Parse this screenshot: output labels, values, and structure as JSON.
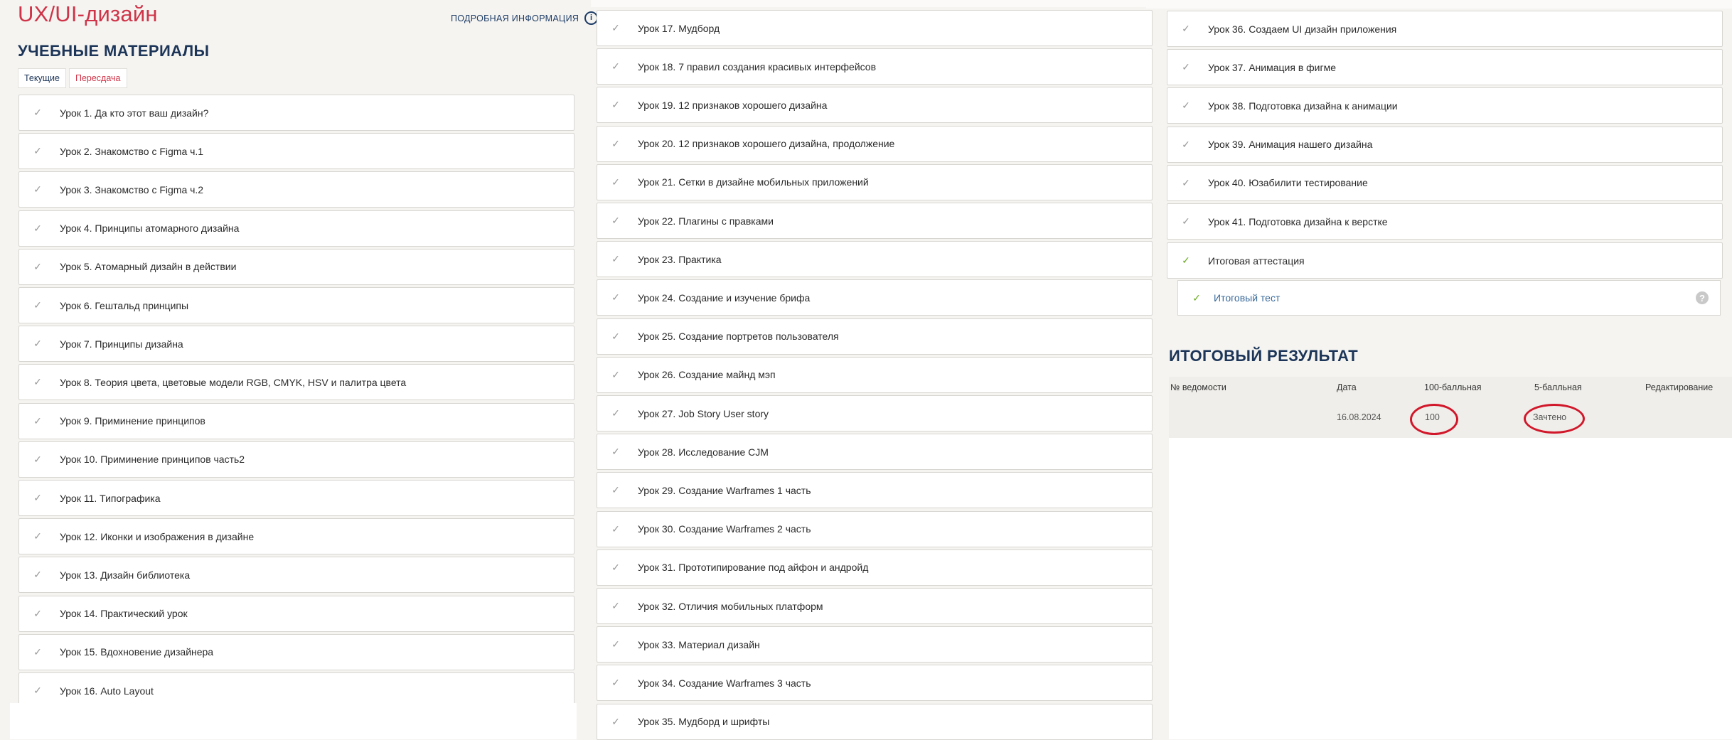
{
  "course": {
    "title": "UX/UI-дизайн",
    "info_link": "ПОДРОБНАЯ ИНФОРМАЦИЯ",
    "info_icon": "info-icon"
  },
  "materials": {
    "title": "УЧЕБНЫЕ МАТЕРИАЛЫ",
    "tabs": [
      {
        "label": "Текущие",
        "active": true
      },
      {
        "label": "Пересдача",
        "active": false
      }
    ]
  },
  "lessons": [
    "Урок 1. Да кто этот ваш дизайн?",
    "Урок 2. Знакомство с Figma ч.1",
    "Урок 3. Знакомство с Figma ч.2",
    "Урок 4. Принципы атомарного дизайна",
    "Урок 5. Атомарный дизайн в действии",
    "Урок 6. Гештальд принципы",
    "Урок 7. Принципы дизайна",
    "Урок 8. Теория цвета, цветовые модели RGB, CMYK, HSV и палитра цвета",
    "Урок 9. Приминение принципов",
    "Урок 10. Приминение принципов часть2",
    "Урок 11. Типографика",
    "Урок 12. Иконки и изображения в дизайне",
    "Урок 13. Дизайн библиотека",
    "Урок 14. Практический урок",
    "Урок 15. Вдохновение дизайнера",
    "Урок 16. Auto Layout",
    "Урок 17. Мудборд",
    "Урок 18. 7 правил создания красивых интерфейсов",
    "Урок 19. 12 признаков хорошего дизайна",
    "Урок 20. 12 признаков хорошего дизайна, продолжение",
    "Урок 21. Сетки в дизайне мобильных приложений",
    "Урок 22. Плагины с правками",
    "Урок 23. Практика",
    "Урок 24. Создание и изучение брифа",
    "Урок 25. Создание портретов пользователя",
    "Урок 26. Создание майнд мэп",
    "Урок 27. Job Story User story",
    "Урок 28. Исследование CJM",
    "Урок 29. Создание Warframes 1 часть",
    "Урок 30. Создание Warframes 2 часть",
    "Урок 31. Прототипирование под айфон и андройд",
    "Урок 32. Отличия мобильных платформ",
    "Урок 33. Материал дизайн",
    "Урок 34. Создание Warframes 3 часть",
    "Урок 35. Мудборд и шрифты",
    "Урок 36. Создаем UI дизайн приложения",
    "Урок 37. Анимация в фигме",
    "Урок 38. Подготовка дизайна к анимации",
    "Урок 39. Анимация нашего дизайна",
    "Урок 40. Юзабилити тестирование",
    "Урок 41. Подготовка дизайна к верстке"
  ],
  "final": {
    "attestation": "Итоговая аттестация",
    "test": "Итоговый тест",
    "help_icon": "?"
  },
  "result": {
    "title": "ИТОГОВЫЙ РЕЗУЛЬТАТ",
    "headers": [
      "№ ведомости",
      "Дата",
      "100-балльная",
      "5-балльная",
      "Редактирование"
    ],
    "row": {
      "number": "",
      "date": "16.08.2024",
      "score100": "100",
      "score5": "Зачтено",
      "edit": ""
    }
  },
  "colors": {
    "accent": "#cf3448",
    "heading": "#1c3558",
    "check_done": "#6bab23",
    "annotation_circle": "#d1182b"
  }
}
